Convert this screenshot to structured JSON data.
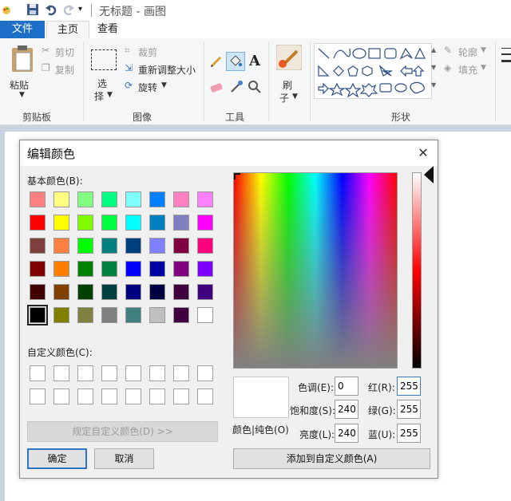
{
  "window": {
    "title": "无标题 - 画图"
  },
  "tabs": {
    "file": "文件",
    "home": "主页",
    "view": "查看"
  },
  "ribbon": {
    "clipboard": {
      "paste": "粘贴",
      "cut": "剪切",
      "copy": "复制",
      "group": "剪贴板"
    },
    "image": {
      "select_1": "选",
      "select_2": "择",
      "crop": "裁剪",
      "resize": "重新调整大小",
      "rotate": "旋转",
      "group": "图像"
    },
    "tools": {
      "group": "工具",
      "text_icon": "A"
    },
    "brush": {
      "label_1": "刷",
      "label_2": "子"
    },
    "shapes": {
      "outline": "轮廓",
      "fill": "填充",
      "group": "形状"
    }
  },
  "dialog": {
    "title": "编辑颜色",
    "basic_label": "基本颜色(B):",
    "custom_label": "自定义颜色(C):",
    "define_custom": "规定自定义颜色(D) >>",
    "ok": "确定",
    "cancel": "取消",
    "color_solid": "颜色|纯色(O)",
    "hue_label": "色调(E):",
    "sat_label": "饱和度(S):",
    "lum_label": "亮度(L):",
    "red_label": "红(R):",
    "green_label": "绿(G):",
    "blue_label": "蓝(U):",
    "hue": "0",
    "sat": "240",
    "lum": "240",
    "red": "255",
    "green": "255",
    "blue": "255",
    "add_custom": "添加到自定义颜色(A)",
    "basic_colors": [
      "#ff8080",
      "#ffff80",
      "#80ff80",
      "#00ff80",
      "#80ffff",
      "#0080ff",
      "#ff80c0",
      "#ff80ff",
      "#ff0000",
      "#ffff00",
      "#80ff00",
      "#00ff40",
      "#00ffff",
      "#0080c0",
      "#8080c0",
      "#ff00ff",
      "#804040",
      "#ff8040",
      "#00ff00",
      "#008080",
      "#004080",
      "#8080ff",
      "#800040",
      "#ff0080",
      "#800000",
      "#ff8000",
      "#008000",
      "#008040",
      "#0000ff",
      "#0000a0",
      "#800080",
      "#8000ff",
      "#400000",
      "#804000",
      "#004000",
      "#004040",
      "#000080",
      "#000040",
      "#400040",
      "#400080",
      "#000000",
      "#808000",
      "#808040",
      "#808080",
      "#408080",
      "#c0c0c0",
      "#400040",
      "#ffffff"
    ]
  }
}
